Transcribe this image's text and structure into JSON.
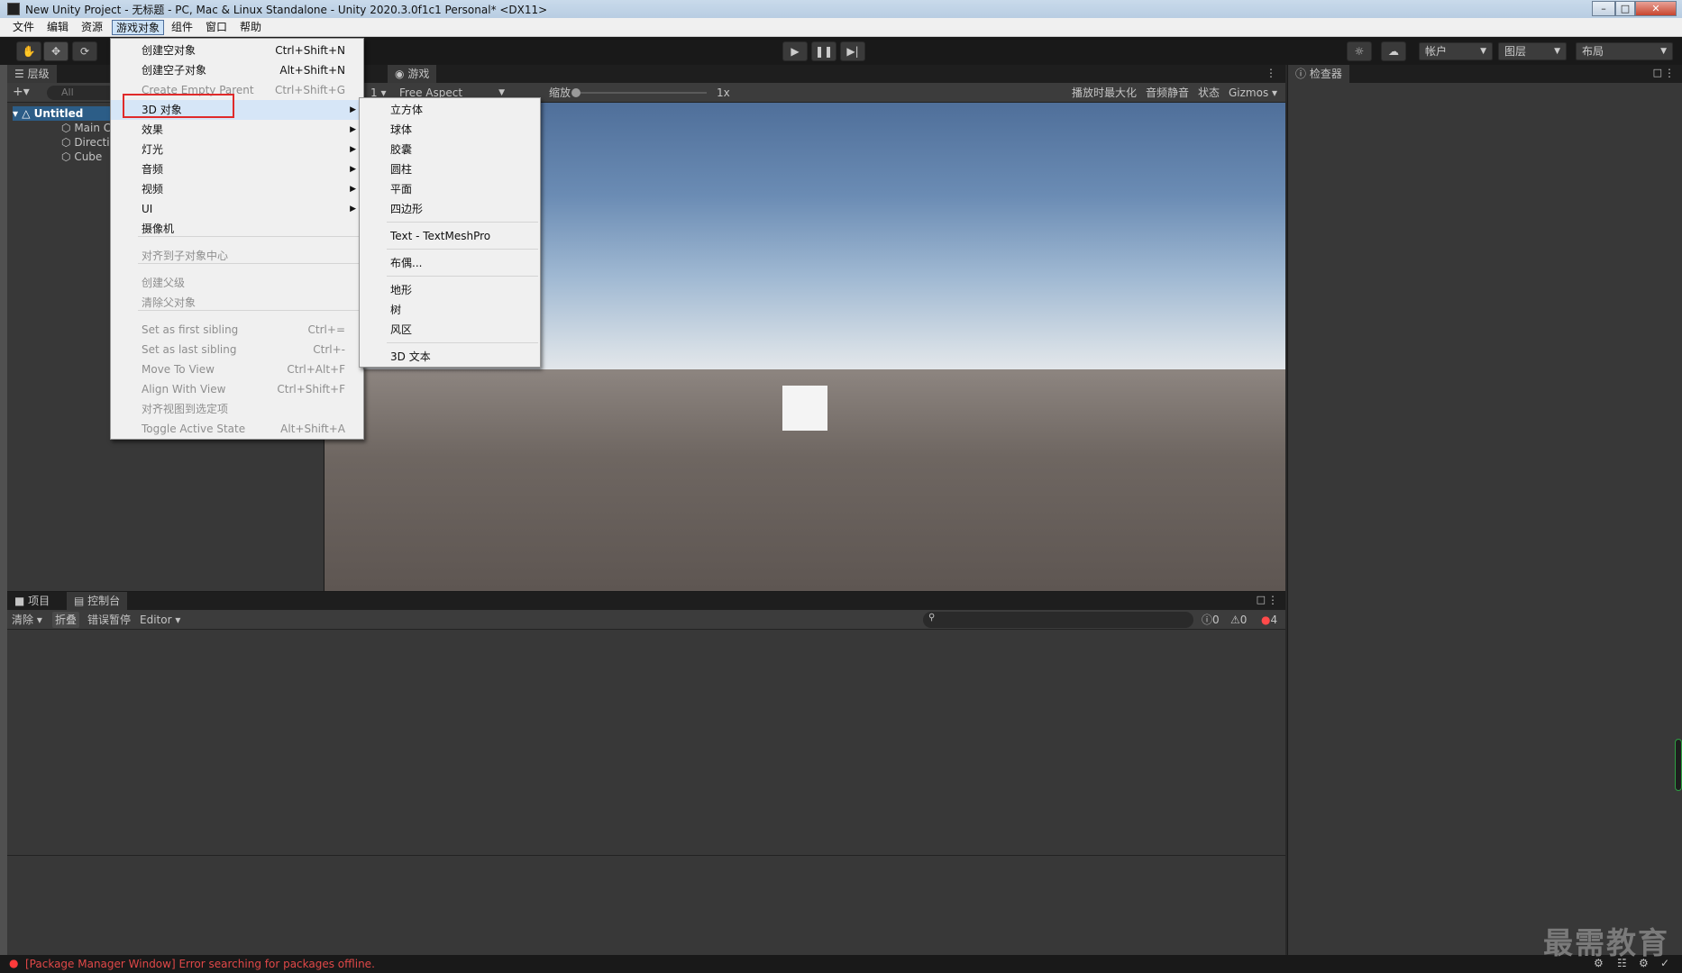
{
  "window": {
    "title": "New Unity Project - 无标题 - PC, Mac & Linux Standalone - Unity 2020.3.0f1c1 Personal* <DX11>"
  },
  "menubar": {
    "items": [
      "文件",
      "编辑",
      "资源",
      "游戏对象",
      "组件",
      "窗口",
      "帮助"
    ],
    "active": "游戏对象"
  },
  "toolbar": {
    "account_label": "帐户",
    "layers_label": "图层",
    "layout_label": "布局"
  },
  "hierarchy": {
    "tab_label": "层级",
    "search_placeholder": "All",
    "scene_name": "Untitled",
    "objects": [
      "Main C",
      "Directi",
      "Cube"
    ]
  },
  "game_view": {
    "tab_label": "游戏",
    "display_number": "1",
    "aspect": "Free Aspect",
    "scale_label": "缩放",
    "scale_value": "1x",
    "buttons": [
      "播放时最大化",
      "音频静音",
      "状态",
      "Gizmos"
    ]
  },
  "inspector": {
    "tab_label": "检查器"
  },
  "bottom_panel": {
    "tabs": [
      "项目",
      "控制台"
    ],
    "clear_label": "清除",
    "collapse_label": "折叠",
    "error_pause_label": "错误暂停",
    "editor_label": "Editor",
    "info_count": "0",
    "warning_count": "0",
    "error_count": "4"
  },
  "status": {
    "message": "[Package Manager Window] Error searching for packages offline."
  },
  "gameobject_menu": {
    "items": [
      {
        "label": "创建空对象",
        "shortcut": "Ctrl+Shift+N",
        "disabled": false,
        "submenu": false
      },
      {
        "label": "创建空子对象",
        "shortcut": "Alt+Shift+N",
        "disabled": false,
        "submenu": false
      },
      {
        "label": "Create Empty Parent",
        "shortcut": "Ctrl+Shift+G",
        "disabled": true,
        "submenu": false
      },
      {
        "label": "3D 对象",
        "shortcut": "",
        "disabled": false,
        "submenu": true
      },
      {
        "label": "效果",
        "shortcut": "",
        "disabled": false,
        "submenu": true
      },
      {
        "label": "灯光",
        "shortcut": "",
        "disabled": false,
        "submenu": true
      },
      {
        "label": "音频",
        "shortcut": "",
        "disabled": false,
        "submenu": true
      },
      {
        "label": "视频",
        "shortcut": "",
        "disabled": false,
        "submenu": true
      },
      {
        "label": "UI",
        "shortcut": "",
        "disabled": false,
        "submenu": true
      },
      {
        "label": "摄像机",
        "shortcut": "",
        "disabled": false,
        "submenu": false
      },
      {
        "label": "对齐到子对象中心",
        "shortcut": "",
        "disabled": true,
        "submenu": false
      },
      {
        "label": "创建父级",
        "shortcut": "",
        "disabled": true,
        "submenu": false
      },
      {
        "label": "清除父对象",
        "shortcut": "",
        "disabled": true,
        "submenu": false
      },
      {
        "label": "Set as first sibling",
        "shortcut": "Ctrl+=",
        "disabled": true,
        "submenu": false
      },
      {
        "label": "Set as last sibling",
        "shortcut": "Ctrl+-",
        "disabled": true,
        "submenu": false
      },
      {
        "label": "Move To View",
        "shortcut": "Ctrl+Alt+F",
        "disabled": true,
        "submenu": false
      },
      {
        "label": "Align With View",
        "shortcut": "Ctrl+Shift+F",
        "disabled": true,
        "submenu": false
      },
      {
        "label": "对齐视图到选定项",
        "shortcut": "",
        "disabled": true,
        "submenu": false
      },
      {
        "label": "Toggle Active State",
        "shortcut": "Alt+Shift+A",
        "disabled": true,
        "submenu": false
      }
    ]
  },
  "submenu_3d": {
    "items": [
      "立方体",
      "球体",
      "胶囊",
      "圆柱",
      "平面",
      "四边形",
      "Text - TextMeshPro",
      "布偶...",
      "地形",
      "树",
      "风区",
      "3D 文本"
    ]
  },
  "watermark": "最需教育"
}
